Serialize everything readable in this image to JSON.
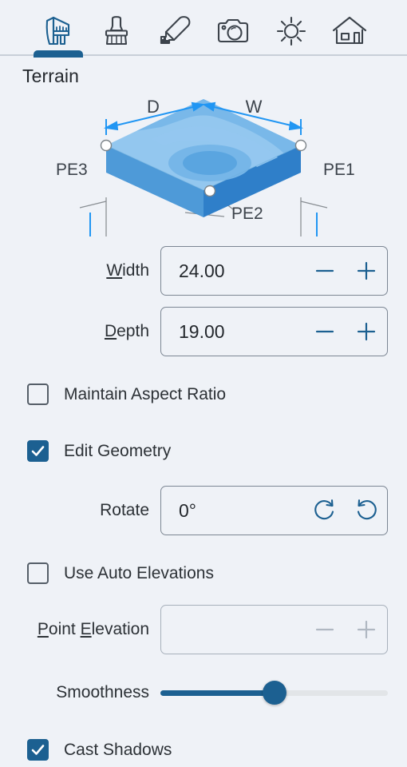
{
  "toolbar": {
    "tabs": [
      {
        "icon": "caliper-icon",
        "name": "tab-terrain",
        "active": true
      },
      {
        "icon": "stamp-icon",
        "name": "tab-stamp",
        "active": false
      },
      {
        "icon": "pencil-icon",
        "name": "tab-pencil",
        "active": false
      },
      {
        "icon": "camera-icon",
        "name": "tab-camera",
        "active": false
      },
      {
        "icon": "sun-icon",
        "name": "tab-sun",
        "active": false
      },
      {
        "icon": "house-icon",
        "name": "tab-house",
        "active": false
      }
    ]
  },
  "panel": {
    "title": "Terrain"
  },
  "diagram": {
    "labels": {
      "depth": "D",
      "width": "W",
      "pe1": "PE1",
      "pe2": "PE2",
      "pe3": "PE3"
    },
    "colors": {
      "top_light": "#93c7ef",
      "top_mid": "#76b6e8",
      "top_dark": "#5aa5e0",
      "side_left": "#4e9ad8",
      "side_right": "#2f7fc9",
      "arrow": "#2196f3",
      "leader": "#8a8f94"
    }
  },
  "fields": {
    "width": {
      "label_pre": "",
      "label_mn": "W",
      "label_post": "idth",
      "value": "24.00",
      "minus": "−",
      "plus": "+",
      "disabled": false
    },
    "depth": {
      "label_pre": "",
      "label_mn": "D",
      "label_post": "epth",
      "value": "19.00",
      "minus": "−",
      "plus": "+",
      "disabled": false
    },
    "rotate": {
      "label": "Rotate",
      "value": "0°",
      "cw_icon": "rotate-cw-icon",
      "ccw_icon": "rotate-ccw-icon"
    },
    "point_elevation": {
      "label_pre": "",
      "label_mn": "P",
      "label_mid": "oint ",
      "label_mn2": "E",
      "label_post": "levation",
      "value": "",
      "minus": "−",
      "plus": "+",
      "disabled": true
    }
  },
  "checkboxes": {
    "maintain_aspect_ratio": {
      "label": "Maintain Aspect Ratio",
      "checked": false
    },
    "edit_geometry": {
      "label": "Edit Geometry",
      "checked": true
    },
    "use_auto_elevations": {
      "label": "Use Auto Elevations",
      "checked": false
    },
    "cast_shadows": {
      "label": "Cast Shadows",
      "checked": true
    }
  },
  "slider": {
    "label": "Smoothness",
    "value_percent": 50
  },
  "colors": {
    "accent": "#1c6091",
    "background": "#eff2f7",
    "text": "#2c3136",
    "border": "#7c8693",
    "disabled": "#a7b0bb"
  }
}
